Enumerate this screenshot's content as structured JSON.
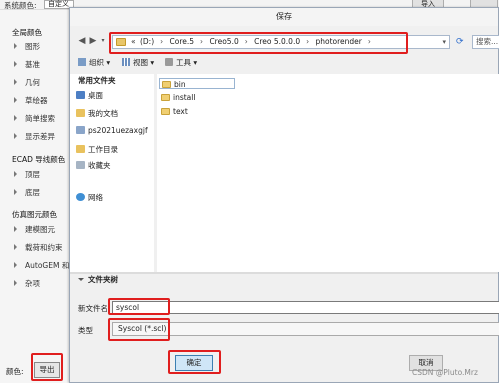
{
  "background": {
    "top_label": "系统颜色:",
    "top_combo": "自定义",
    "top_button": "导入",
    "groups": [
      {
        "title": "全局颜色",
        "items": [
          "图形",
          "基准",
          "几何",
          "草绘器",
          "简单搜索",
          "显示差异"
        ]
      },
      {
        "title": "ECAD 导线颜色",
        "items": [
          "顶层",
          "底层"
        ]
      },
      {
        "title": "仿真图元颜色",
        "items": [
          "建模图元",
          "载荷和约束",
          "AutoGEM 和",
          "杂项"
        ]
      }
    ],
    "bottom_label": "颜色:",
    "export_button": "导出"
  },
  "dialog": {
    "title": "保存",
    "back_icon": "back-arrow-icon",
    "forward_icon": "forward-arrow-icon",
    "breadcrumb": [
      "«",
      "(D:)",
      "Core.5",
      "Creo5.0",
      "Creo 5.0.0.0",
      "photorender"
    ],
    "breadcrumb_separator": "›",
    "search_placeholder": "搜索...",
    "toolbar": {
      "organize": "组织 ▾",
      "views": "视图 ▾",
      "tools": "工具 ▾"
    },
    "nav": {
      "header": "常用文件夹",
      "items": [
        "桌面",
        "我的文档",
        "ps2021uezaxgjf",
        "工作目录",
        "收藏夹",
        "网络"
      ]
    },
    "files": [
      "bin",
      "install",
      "text"
    ],
    "collapse_label": "文件夹树",
    "filename_label": "新文件名",
    "filename_value": "syscol",
    "type_label": "类型",
    "type_value": "Syscol (*.scl)",
    "ok_button": "确定",
    "cancel_button": "取消"
  },
  "watermark": "CSDN @Pluto.Mrz",
  "colors": {
    "highlight": "#e01e1e",
    "folder": "#f0cf72",
    "primary_button": "#cfe6f7"
  }
}
